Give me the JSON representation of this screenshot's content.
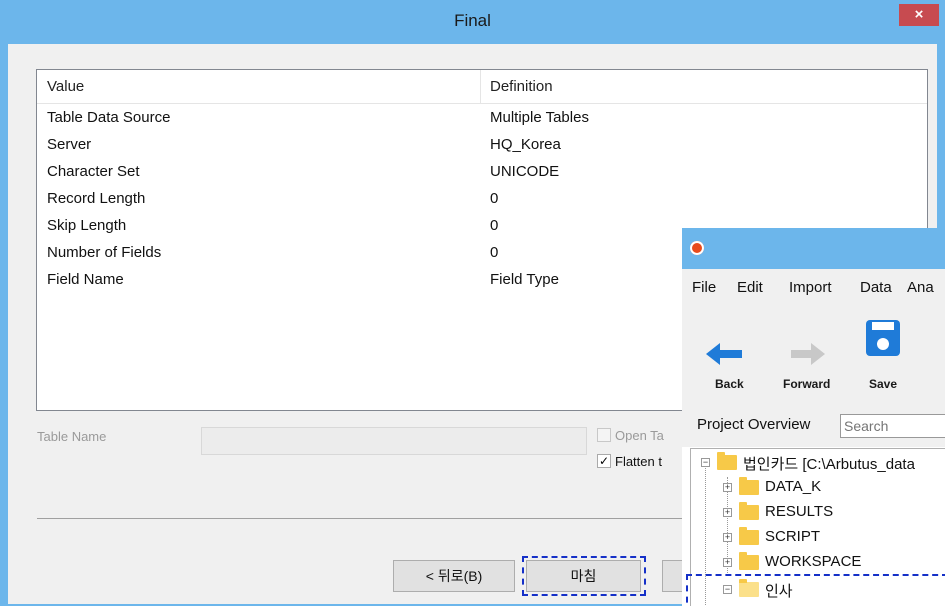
{
  "dialog": {
    "title": "Final",
    "close_label": "×",
    "list": {
      "columns": [
        "Value",
        "Definition"
      ],
      "rows": [
        {
          "value": "Table Data Source",
          "definition": "Multiple Tables"
        },
        {
          "value": "Server",
          "definition": "HQ_Korea"
        },
        {
          "value": "Character Set",
          "definition": "UNICODE"
        },
        {
          "value": "Record Length",
          "definition": "0"
        },
        {
          "value": "Skip Length",
          "definition": "0"
        },
        {
          "value": "Number of Fields",
          "definition": "0"
        },
        {
          "value": "Field Name",
          "definition": "Field Type"
        }
      ]
    },
    "table_name_label": "Table Name",
    "table_name_value": "",
    "open_table_label": "Open Ta",
    "open_table_checked": false,
    "flatten_label": "Flatten t",
    "flatten_checked": true,
    "back_button": "< 뒤로(B)",
    "finish_button": "마침"
  },
  "app": {
    "menu": [
      "File",
      "Edit",
      "Import",
      "Data",
      "Ana"
    ],
    "toolbar": {
      "back": "Back",
      "forward": "Forward",
      "save": "Save"
    },
    "project_overview_label": "Project Overview",
    "search_placeholder": "Search",
    "tree": {
      "root": "법인카드 [C:\\Arbutus_data",
      "children": [
        "DATA_K",
        "RESULTS",
        "SCRIPT",
        "WORKSPACE"
      ],
      "second_root": "인사"
    }
  },
  "colors": {
    "titlebar": "#6cb6eb",
    "close": "#c74b50",
    "highlight_dash": "#1530c8",
    "folder": "#f7c948"
  }
}
